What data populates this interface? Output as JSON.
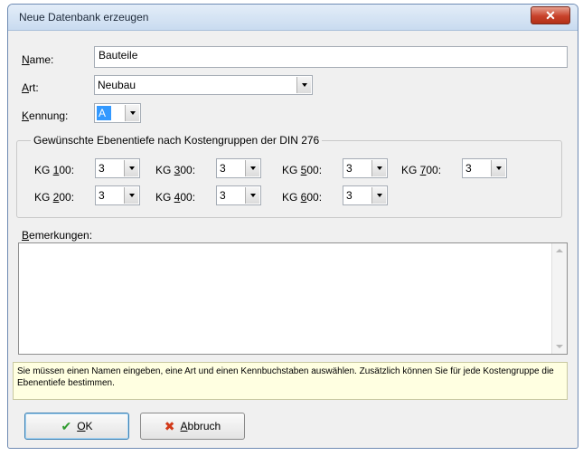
{
  "window": {
    "title": "Neue Datenbank erzeugen",
    "close_glyph": "✕"
  },
  "fields": {
    "name_label_accel": "N",
    "name_label_rest": "ame:",
    "name_value": "Bauteile",
    "art_label_accel": "A",
    "art_label_rest": "rt:",
    "art_value": "Neubau",
    "kennung_label_accel": "K",
    "kennung_label_rest": "ennung:",
    "kennung_value": "A"
  },
  "group": {
    "title": "Gewünschte Ebenentiefe nach Kostengruppen der DIN 276",
    "kg100": {
      "pre": "KG ",
      "accel": "1",
      "post": "00:",
      "value": "3"
    },
    "kg200": {
      "pre": "KG ",
      "accel": "2",
      "post": "00:",
      "value": "3"
    },
    "kg300": {
      "pre": "KG ",
      "accel": "3",
      "post": "00:",
      "value": "3"
    },
    "kg400": {
      "pre": "KG ",
      "accel": "4",
      "post": "00:",
      "value": "3"
    },
    "kg500": {
      "pre": "KG ",
      "accel": "5",
      "post": "00:",
      "value": "3"
    },
    "kg600": {
      "pre": "KG ",
      "accel": "6",
      "post": "00:",
      "value": "3"
    },
    "kg700": {
      "pre": "KG ",
      "accel": "7",
      "post": "00:",
      "value": "3"
    }
  },
  "remarks": {
    "label_accel": "B",
    "label_rest": "emerkungen:",
    "value": ""
  },
  "hint": "Sie müssen einen Namen eingeben, eine Art und einen Kennbuchstaben auswählen. Zusätzlich können Sie für jede Kostengruppe die Ebenentiefe bestimmen.",
  "buttons": {
    "ok_accel": "O",
    "ok_rest": "K",
    "ok_icon": "✔",
    "cancel_accel": "A",
    "cancel_rest": "bbruch",
    "cancel_icon": "✖"
  },
  "colors": {
    "ok_check": "#2e9a2e",
    "cancel_x": "#d23a1a",
    "selection": "#3399ff"
  }
}
